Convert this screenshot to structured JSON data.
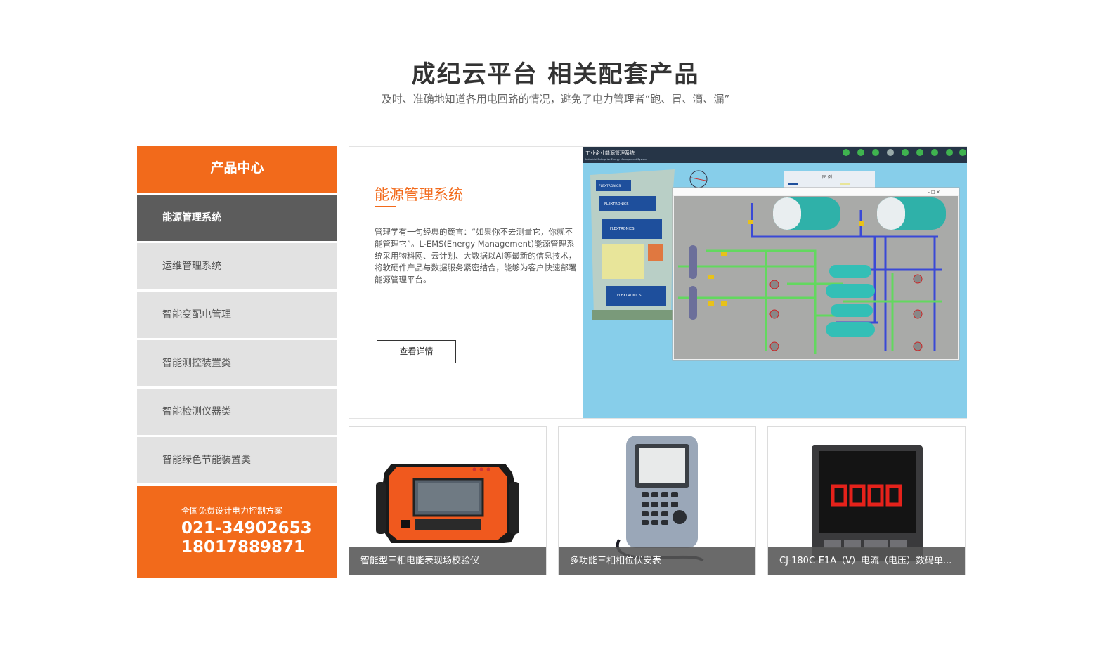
{
  "header": {
    "title": "成纪云平台 相关配套产品",
    "subtitle": "及时、准确地知道各用电回路的情况，避免了电力管理者“跑、冒、滴、漏”"
  },
  "sidebar": {
    "title": "产品中心",
    "items": [
      {
        "label": "能源管理系统",
        "active": true
      },
      {
        "label": "运维管理系统",
        "active": false
      },
      {
        "label": "智能变配电管理",
        "active": false
      },
      {
        "label": "智能测控装置类",
        "active": false
      },
      {
        "label": "智能检测仪器类",
        "active": false
      },
      {
        "label": "智能绿色节能装置类",
        "active": false
      }
    ],
    "contact": {
      "label": "全国免费设计电力控制方案",
      "phone1": "021-34902653",
      "phone2": "18017889871"
    }
  },
  "feature": {
    "title": "能源管理系统",
    "description": "管理学有一句经典的箴言：“如果你不去测量它，你就不能管理它”。L-EMS(Energy Management)能源管理系统采用物料网、云计划、大数据以AI等最新的信息技术，将软硬件产品与数据服务紧密结合，能够为客户快速部署能源管理平台。",
    "button_label": "查看详情",
    "screenshot": {
      "app_title": "工业企业能源管理系统",
      "app_subtitle": "Industrial Enterprise Energy Management System",
      "legend_title": "图 例",
      "buildings": [
        "FLEXTRONICS",
        "FLEXTRONICS",
        "FLEXTRONICS",
        "FLEXTRONICS"
      ]
    }
  },
  "products": [
    {
      "name": "智能型三相电能表现场校验仪"
    },
    {
      "name": "多功能三相相位伏安表"
    },
    {
      "name": "CJ-180C-E1A（V）电流（电压）数码单..."
    }
  ],
  "colors": {
    "accent": "#f26a1b",
    "active_item": "#5c5c5c",
    "inactive_item": "#e2e2e2"
  }
}
